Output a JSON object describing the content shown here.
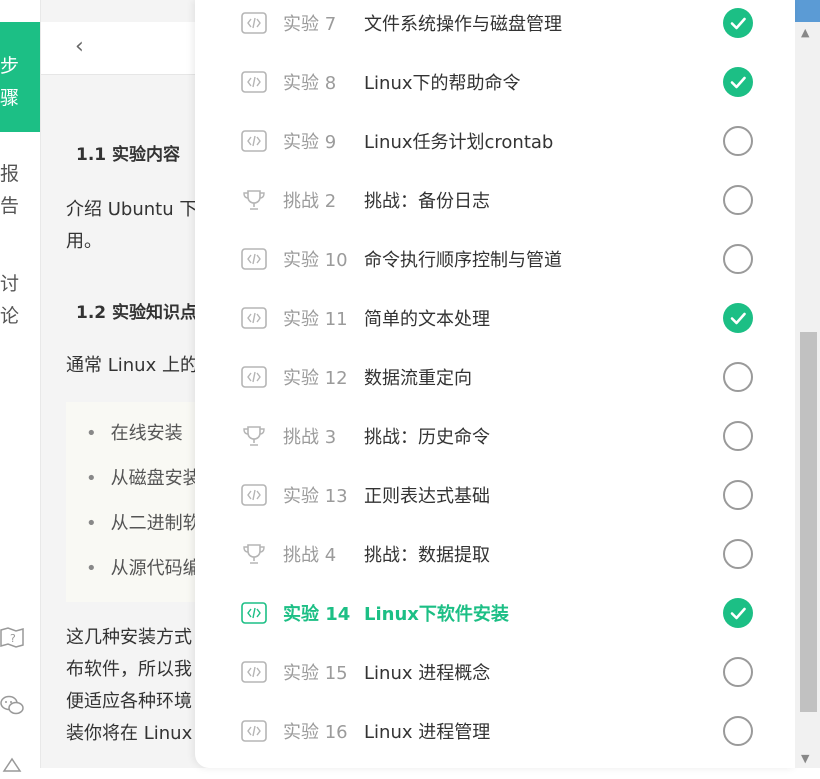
{
  "rail": {
    "tab_steps": "步骤",
    "tab_report": "报告",
    "tab_discuss": "讨论"
  },
  "header": {
    "back_glyph": "‹"
  },
  "article": {
    "h1": "1.1 实验内容",
    "p1_line1": "介绍 Ubuntu 下",
    "p1_line2": "用。",
    "h2": "1.2 实验知识点",
    "p2": "通常 Linux 上的",
    "bullets": [
      "在线安装",
      "从磁盘安装",
      "从二进制软",
      "从源代码编"
    ],
    "p3_lines": [
      "这几种安装方式",
      "布软件，所以我",
      "便适应各种环境",
      "装你将在 Linux"
    ]
  },
  "labs": [
    {
      "kind": "实验 7",
      "title": "文件系统操作与磁盘管理",
      "type": "code",
      "done": true,
      "current": false
    },
    {
      "kind": "实验 8",
      "title": "Linux下的帮助命令",
      "type": "code",
      "done": true,
      "current": false
    },
    {
      "kind": "实验 9",
      "title": "Linux任务计划crontab",
      "type": "code",
      "done": false,
      "current": false
    },
    {
      "kind": "挑战 2",
      "title": "挑战：备份日志",
      "type": "trophy",
      "done": false,
      "current": false
    },
    {
      "kind": "实验 10",
      "title": "命令执行顺序控制与管道",
      "type": "code",
      "done": false,
      "current": false
    },
    {
      "kind": "实验 11",
      "title": "简单的文本处理",
      "type": "code",
      "done": true,
      "current": false
    },
    {
      "kind": "实验 12",
      "title": "数据流重定向",
      "type": "code",
      "done": false,
      "current": false
    },
    {
      "kind": "挑战 3",
      "title": "挑战：历史命令",
      "type": "trophy",
      "done": false,
      "current": false
    },
    {
      "kind": "实验 13",
      "title": "正则表达式基础",
      "type": "code",
      "done": false,
      "current": false
    },
    {
      "kind": "挑战 4",
      "title": "挑战：数据提取",
      "type": "trophy",
      "done": false,
      "current": false
    },
    {
      "kind": "实验 14",
      "title": "Linux下软件安装",
      "type": "code",
      "done": true,
      "current": true
    },
    {
      "kind": "实验 15",
      "title": "Linux 进程概念",
      "type": "code",
      "done": false,
      "current": false
    },
    {
      "kind": "实验 16",
      "title": "Linux 进程管理",
      "type": "code",
      "done": false,
      "current": false
    }
  ],
  "colors": {
    "accent": "#1cbf85",
    "blue": "#5b9bd5"
  },
  "icons": {
    "code": "code-icon",
    "trophy": "trophy-icon",
    "done": "check-circle-icon",
    "todo": "empty-circle-icon"
  }
}
